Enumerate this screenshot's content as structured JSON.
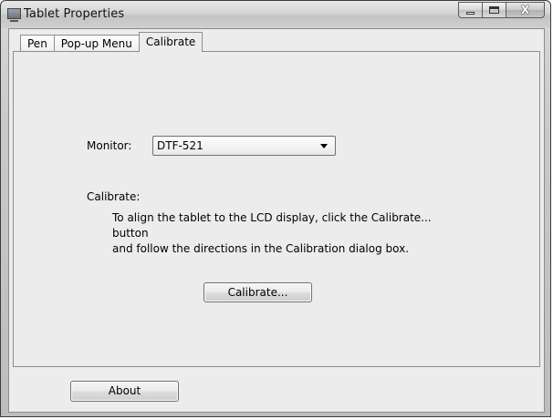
{
  "window": {
    "title": "Tablet Properties"
  },
  "tabs": [
    {
      "label": "Pen",
      "active": false
    },
    {
      "label": "Pop-up Menu",
      "active": false
    },
    {
      "label": "Calibrate",
      "active": true
    }
  ],
  "calibrate_page": {
    "monitor_label": "Monitor:",
    "monitor_selected": "DTF-521",
    "calibrate_label": "Calibrate:",
    "instructions_line1": "To align the tablet to the LCD display, click the Calibrate... button",
    "instructions_line2": "and follow the directions in the Calibration dialog box.",
    "calibrate_button": "Calibrate..."
  },
  "footer": {
    "about_button": "About"
  },
  "icons": {
    "title_icon": "tablet-window-icon",
    "minimize": "minimize-icon",
    "maximize": "maximize-icon",
    "close": "close-icon",
    "dropdown": "chevron-down-icon"
  },
  "close_glyph": "X"
}
